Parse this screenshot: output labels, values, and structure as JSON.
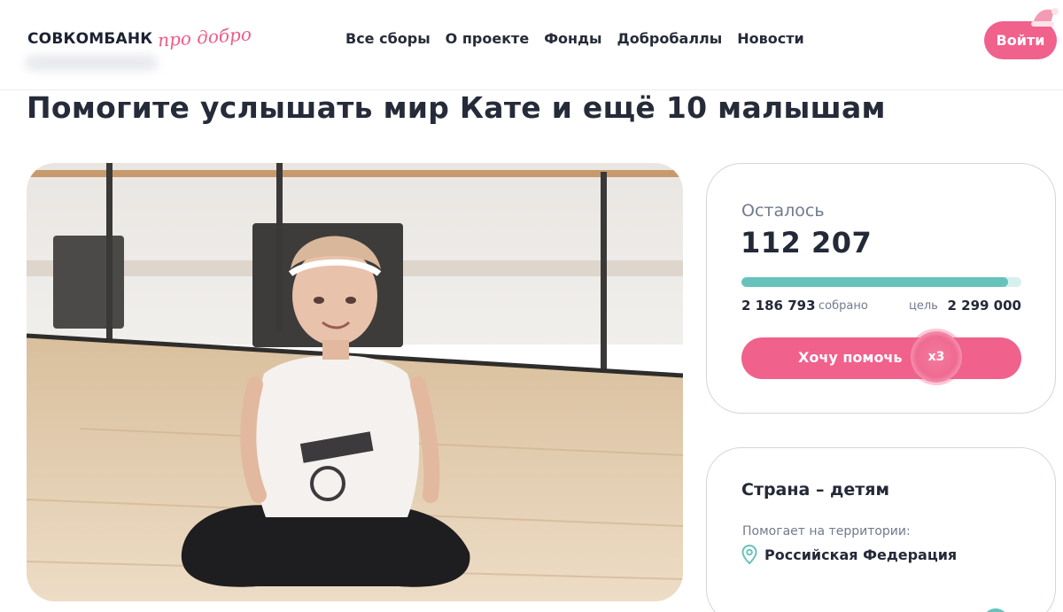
{
  "header": {
    "logo_main": "СОВКОМБАНК",
    "logo_script": "про добро",
    "nav": [
      "Все сборы",
      "О проекте",
      "Фонды",
      "Добробаллы",
      "Новости"
    ],
    "login_label": "Войти"
  },
  "page": {
    "title": "Помогите услышать мир Кате и ещё 10 малышам"
  },
  "donation": {
    "remaining_label": "Осталось",
    "remaining_value": "112 207",
    "progress": 0.951,
    "collected_amount": "2 186 793",
    "collected_label": "собрано",
    "goal_label": "цель",
    "goal_amount": "2 299 000",
    "help_label": "Хочу помочь",
    "multiplier": "x3"
  },
  "fund": {
    "name": "Страна – детям",
    "territory_label": "Помогает на территории:",
    "location": "Российская Федерация"
  },
  "colors": {
    "accent": "#f0618c",
    "progress": "#67c2bc",
    "text": "#242938"
  },
  "icons": {
    "pin": "map-pin-icon",
    "hat": "santa-hat-icon"
  }
}
